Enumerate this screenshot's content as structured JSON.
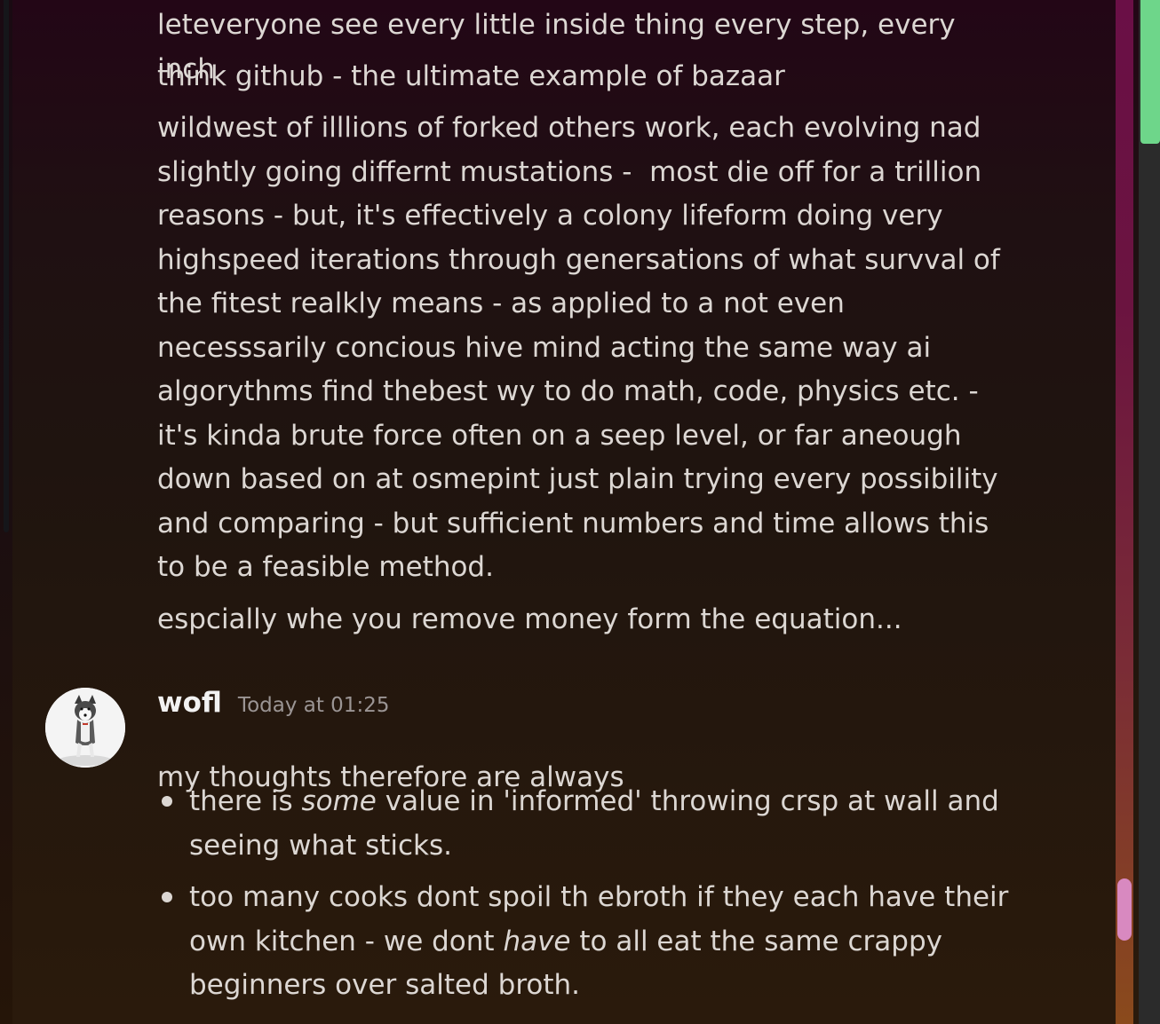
{
  "messages_before": [
    "leteveryone see every little inside thing every step, every inch",
    "think github - the ultimate example of bazaar",
    "wildwest of illlions of forked others work, each evolving nad slightly going differnt mustations -  most die off for a trillion reasons - but, it's effectively a colony lifeform doing very highspeed iterations through genersations of what survval of the fitest realkly means - as applied to a not even necesssarily concious hive mind acting the same way ai  algorythms find thebest wy to do math, code, physics etc. - it's kinda brute force often on a seep level, or far aneough down based on at osmepint just plain trying every possibility and comparing - but sufficient numbers and time allows this to be a feasible method.",
    "espcially whe you remove money form the equation..."
  ],
  "post": {
    "author": "wofl",
    "timestamp": "Today at 01:25",
    "avatar_icon": "husky-avatar",
    "intro": "my thoughts therefore are always",
    "bullets": [
      {
        "before": "there is ",
        "emphasis": "some",
        "after": " value in 'informed'  throwing crsp at wall and seeing what sticks."
      },
      {
        "before": "too many cooks dont spoil th ebroth if they each have their own kitchen - we dont ",
        "emphasis": "have",
        "after": " to all eat the same crappy beginners over salted broth."
      }
    ]
  },
  "colors": {
    "text": "#dcd7d3",
    "author": "#f2f2f2",
    "timestamp": "#9b9594",
    "chat_scrollbar_thumb": "#d889c0",
    "page_scrollbar_thumb": "#6ed68a"
  }
}
